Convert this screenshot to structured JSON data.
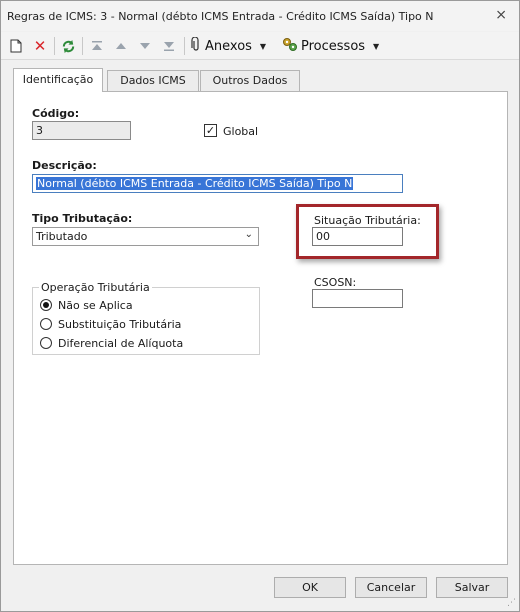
{
  "window": {
    "title": "Regras de ICMS: 3 - Normal (débto ICMS Entrada - Crédito ICMS Saída) Tipo N",
    "close_icon": "close-icon"
  },
  "toolbar": {
    "icons": [
      "new-document-icon",
      "delete-icon",
      "refresh-icon",
      "first-record-icon",
      "previous-record-icon",
      "next-record-icon",
      "last-record-icon"
    ],
    "anexos_label": "Anexos",
    "processos_label": "Processos",
    "delete_color": "#d9262b",
    "refresh_color": "#2e8b3a"
  },
  "tabs": [
    {
      "label": "Identificação",
      "active": true
    },
    {
      "label": "Dados ICMS",
      "active": false
    },
    {
      "label": "Outros Dados",
      "active": false
    }
  ],
  "form": {
    "codigo_label": "Código:",
    "codigo_value": "3",
    "global_label": "Global",
    "global_checked": true,
    "descricao_label": "Descrição:",
    "descricao_value": "Normal (débto ICMS Entrada - Crédito ICMS Saída) Tipo N",
    "tipo_tributacao_label": "Tipo Tributação:",
    "tipo_tributacao_value": "Tributado",
    "situacao_tributaria_label": "Situação Tributária:",
    "situacao_tributaria_value": "00",
    "csosn_label": "CSOSN:",
    "csosn_value": "",
    "operacao_label": "Operação Tributária",
    "operacao_options": [
      {
        "label": "Não se Aplica",
        "selected": true
      },
      {
        "label": "Substituição Tributária",
        "selected": false
      },
      {
        "label": "Diferencial de Alíquota",
        "selected": false
      }
    ]
  },
  "highlight_color": "#a3262a",
  "footer": {
    "ok_label": "OK",
    "cancel_label": "Cancelar",
    "save_label": "Salvar"
  }
}
